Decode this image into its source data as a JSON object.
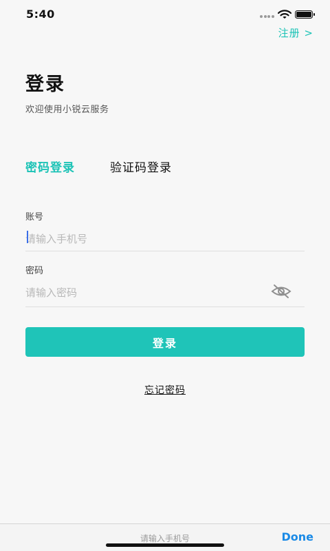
{
  "status_bar": {
    "time": "5:40"
  },
  "header": {
    "register_link": "注册 >"
  },
  "main": {
    "title": "登录",
    "subtitle": "欢迎使用小锐云服务",
    "tabs": [
      {
        "label": "密码登录",
        "active": true
      },
      {
        "label": "验证码登录",
        "active": false
      }
    ],
    "account_label": "账号",
    "account_placeholder": "请输入手机号",
    "account_value": "",
    "password_label": "密码",
    "password_placeholder": "请输入密码",
    "password_value": "",
    "password_visibility_icon": "eye-off-icon",
    "login_button": "登录",
    "forgot_password": "忘记密码"
  },
  "keyboard_toolbar": {
    "hint": "请输入手机号",
    "done": "Done"
  },
  "colors": {
    "accent": "#1cc3b6",
    "button_bg": "#1fc4b8",
    "done_blue": "#1a8ae6",
    "background": "#f7f7f7"
  }
}
